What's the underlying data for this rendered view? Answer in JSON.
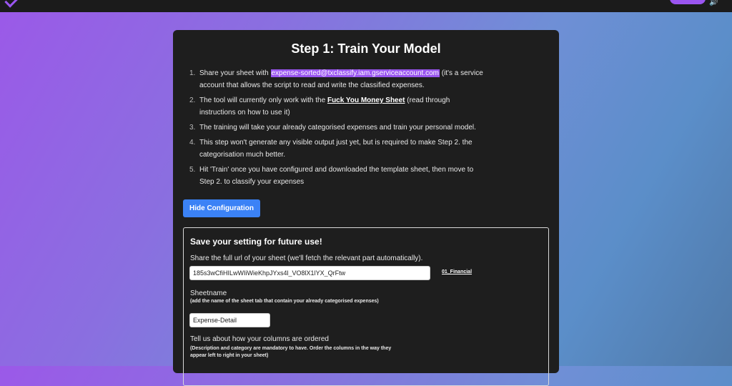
{
  "header": {
    "brand_color": "#9a55f0",
    "icon_name": "speaker-icon",
    "icon_glyph": "🔊"
  },
  "card": {
    "title": "Step 1: Train Your Model",
    "steps": [
      {
        "num": "1.",
        "pre": "Share your sheet with ",
        "email": "expense-sorted@txclassify.iam.gserviceaccount.com",
        "post": " (it's a service account that allows the script to read and write the classified expenses."
      },
      {
        "num": "2.",
        "pre": "The tool will currently only work with the ",
        "link": "Fuck You Money Sheet",
        "post": " (read through instructions on how to use it)"
      },
      {
        "num": "3.",
        "text": "The training will take your already categorised expenses and train your personal model."
      },
      {
        "num": "4.",
        "text": "This step won't generate any visible output just yet, but is required to make Step 2. the categorisation much better."
      },
      {
        "num": "5.",
        "text": "Hit 'Train' once you have configured and downloaded the template sheet, then move to Step 2. to classify your expenses"
      }
    ],
    "hide_button": "Hide Configuration"
  },
  "config": {
    "title": "Save your setting for future use!",
    "share_label": "Share the full url of your sheet (we'll fetch the relevant part automatically).",
    "url_value": "185s3wCfiHILwWIiWieKhpJYxs4l_VO8lX1lYX_QrFtw",
    "sheet_link": "01_Financial",
    "sheetname_label": "Sheetname",
    "sheetname_hint": "(add the name of the sheet tab that contain your already categorised expenses)",
    "sheetname_value": "Expense-Detail",
    "columns_label": "Tell us about how your columns are ordered",
    "columns_hint": "(Description and category are mandatory to have. Order the columns in the way they appear left to right in your sheet)"
  }
}
